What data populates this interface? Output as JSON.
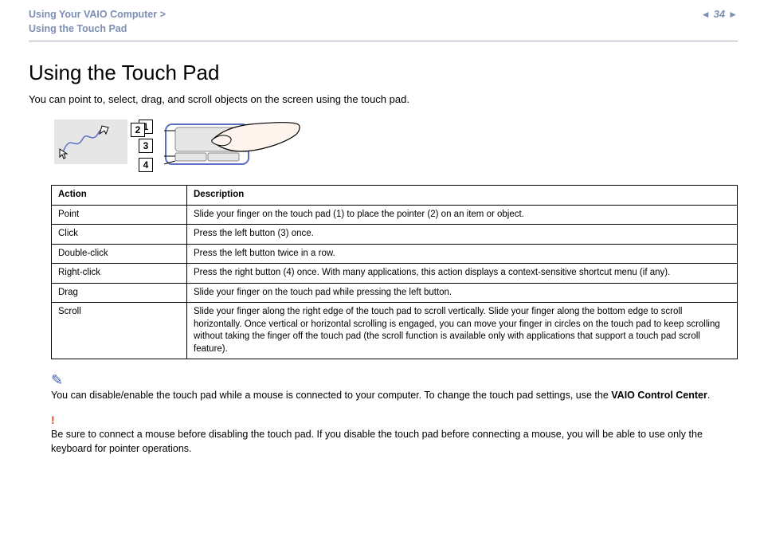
{
  "header": {
    "breadcrumb_line1": "Using Your VAIO Computer >",
    "breadcrumb_line2": "Using the Touch Pad",
    "page_number": "34",
    "prev_icon": "◄",
    "next_icon": "►"
  },
  "title": "Using the Touch Pad",
  "intro": "You can point to, select, drag, and scroll objects on the screen using the touch pad.",
  "callouts": {
    "c1": "1",
    "c2": "2",
    "c3": "3",
    "c4": "4"
  },
  "table": {
    "head_action": "Action",
    "head_desc": "Description",
    "rows": [
      {
        "action": "Point",
        "desc": "Slide your finger on the touch pad (1) to place the pointer (2) on an item or object."
      },
      {
        "action": "Click",
        "desc": "Press the left button (3) once."
      },
      {
        "action": "Double-click",
        "desc": "Press the left button twice in a row."
      },
      {
        "action": "Right-click",
        "desc": "Press the right button (4) once. With many applications, this action displays a context-sensitive shortcut menu (if any)."
      },
      {
        "action": "Drag",
        "desc": "Slide your finger on the touch pad while pressing the left button."
      },
      {
        "action": "Scroll",
        "desc": "Slide your finger along the right edge of the touch pad to scroll vertically. Slide your finger along the bottom edge to scroll horizontally. Once vertical or horizontal scrolling is engaged, you can move your finger in circles on the touch pad to keep scrolling without taking the finger off the touch pad (the scroll function is available only with applications that support a touch pad scroll feature)."
      }
    ]
  },
  "note": {
    "text_a": "You can disable/enable the touch pad while a mouse is connected to your computer. To change the touch pad settings, use the ",
    "bold": "VAIO Control Center",
    "text_b": "."
  },
  "warning": {
    "bang": "!",
    "text": "Be sure to connect a mouse before disabling the touch pad. If you disable the touch pad before connecting a mouse, you will be able to use only the keyboard for pointer operations."
  }
}
